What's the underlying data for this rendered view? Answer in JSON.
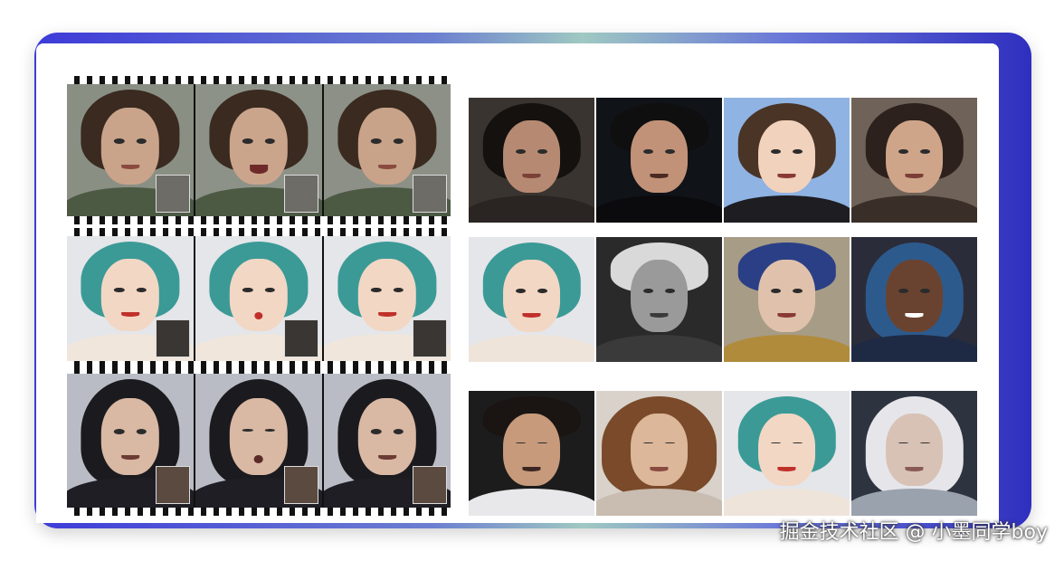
{
  "watermark": "掘金技术社区 @ 小墨同学boy",
  "colors": {
    "frame_accent": "#3d3bd8",
    "teal_hair": "#3b9a96",
    "dark_hair": "#1b1b1f",
    "brown_hair": "#4a3426"
  },
  "left_strips": [
    {
      "style": "photo-woman",
      "frames": 3
    },
    {
      "style": "cartoon-teal",
      "frames": 3
    },
    {
      "style": "cartoon-dark-man",
      "frames": 3
    }
  ],
  "right_rows": [
    [
      "woman-dark-bob",
      "man-tuxedo",
      "cartoon-woman-brown",
      "woman-buns-city"
    ],
    [
      "cartoon-teal",
      "elderly-man-bw",
      "fantasy-blue-hair",
      "woman-blue-braids"
    ],
    [
      "man-beard-eyes-closed",
      "woman-curly-eyes-closed",
      "cartoon-teal-eyes-closed",
      "woman-white-hair"
    ]
  ]
}
